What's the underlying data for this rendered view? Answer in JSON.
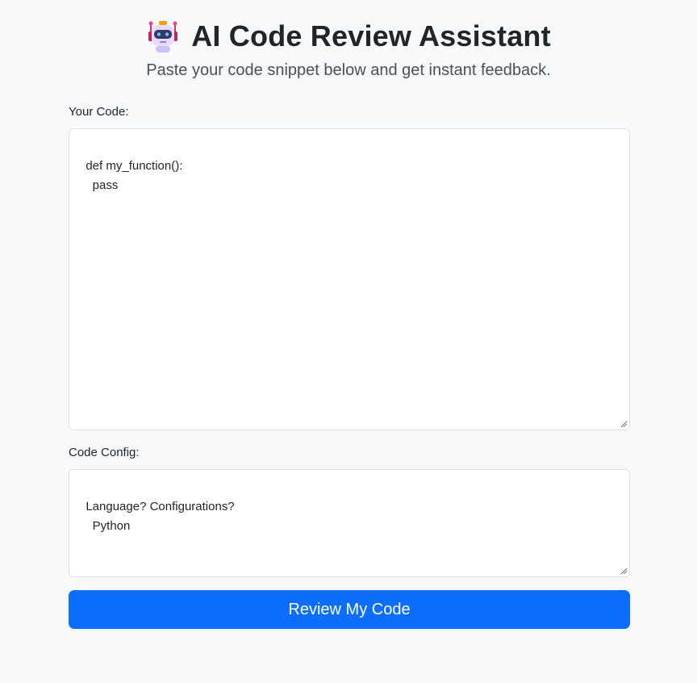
{
  "header": {
    "icon": "robot-icon",
    "title": "AI Code Review Assistant",
    "subtitle": "Paste your code snippet below and get instant feedback."
  },
  "code_input": {
    "label": "Your Code:",
    "value": "def my_function():\n    pass"
  },
  "config_input": {
    "label": "Code Config:",
    "value": "Language? Configurations?\n    Python"
  },
  "submit": {
    "label": "Review My Code",
    "color": "#0d6efd"
  }
}
